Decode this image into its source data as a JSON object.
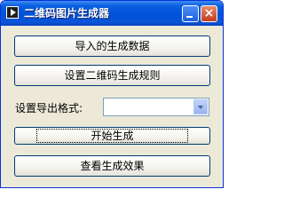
{
  "window": {
    "title": "二维码图片生成器",
    "close_glyph": "×"
  },
  "buttons": {
    "import_label": "导入的生成数据",
    "rule_label": "设置二维码生成规则",
    "start_label": "开始生成",
    "view_label": "查看生成效果"
  },
  "format": {
    "label": "设置导出格式:",
    "selected": ""
  },
  "icons": {
    "app": "app-icon",
    "minimize": "minimize-icon",
    "close": "close-icon",
    "dropdown": "chevron-down-icon"
  },
  "colors": {
    "titlebar": "#0050d8",
    "window_bg": "#ece9d8",
    "close_button": "#c43b1e"
  }
}
